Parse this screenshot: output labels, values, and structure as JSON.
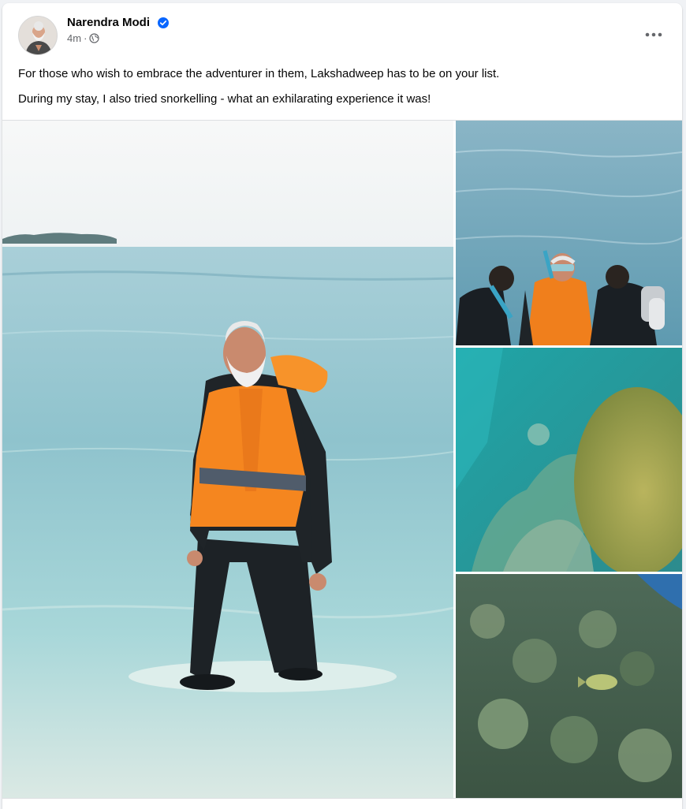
{
  "post": {
    "author": {
      "name": "Narendra Modi",
      "verified": true,
      "avatar_icon": "profile-avatar"
    },
    "timestamp": "4m",
    "separator": "·",
    "audience_icon": "globe-icon",
    "more_icon": "more-horizontal-icon",
    "text_lines": [
      "For those who wish to embrace the adventurer in them, Lakshadweep has to be on your list.",
      "During my stay, I also tried snorkelling - what an exhilarating experience it was!"
    ],
    "photos": [
      {
        "name": "photo-man-in-life-jacket-walking-in-sea"
      },
      {
        "name": "photo-snorkelling-with-divers"
      },
      {
        "name": "photo-underwater-coral"
      },
      {
        "name": "photo-coral-reef-with-fish"
      }
    ]
  },
  "colors": {
    "verified_badge": "#0866ff",
    "text_primary": "#050505",
    "text_secondary": "#65676b",
    "page_background": "#f0f2f5"
  }
}
